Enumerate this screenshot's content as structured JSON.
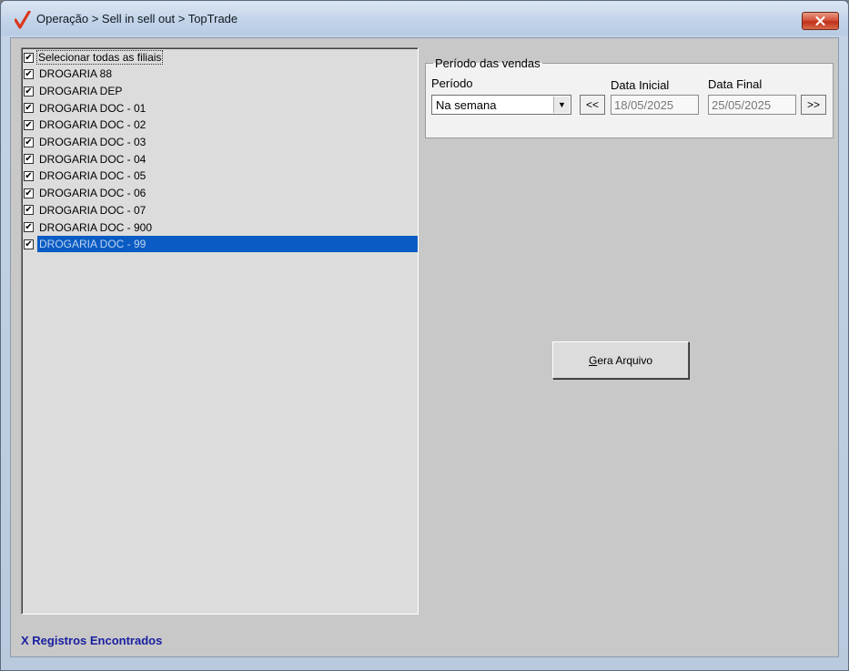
{
  "window": {
    "title": "Operação > Sell in sell out > TopTrade",
    "accent_color": "#d9381e",
    "close_icon": "close-icon"
  },
  "left": {
    "select_all_label": "Selecionar todas as filiais",
    "select_all_checked": true,
    "items": [
      {
        "label": "DROGARIA 88",
        "checked": true
      },
      {
        "label": "DROGARIA DEP",
        "checked": true
      },
      {
        "label": "DROGARIA DOC - 01",
        "checked": true
      },
      {
        "label": "DROGARIA DOC - 02",
        "checked": true
      },
      {
        "label": "DROGARIA DOC - 03",
        "checked": true
      },
      {
        "label": "DROGARIA DOC - 04",
        "checked": true
      },
      {
        "label": "DROGARIA DOC - 05",
        "checked": true
      },
      {
        "label": "DROGARIA DOC - 06",
        "checked": true
      },
      {
        "label": "DROGARIA DOC - 07",
        "checked": true
      },
      {
        "label": "DROGARIA DOC - 900",
        "checked": true
      },
      {
        "label": "DROGARIA DOC - 99",
        "checked": true
      }
    ],
    "selected_item": "DROGARIA DOC - 99",
    "status": "X Registros Encontrados"
  },
  "periodo": {
    "group_title": "Período das vendas",
    "period_label": "Período",
    "period_value": "Na semana",
    "prev_label": "<<",
    "next_label": ">>",
    "start_label": "Data Inicial",
    "start_value": "18/05/2025",
    "end_label": "Data Final",
    "end_value": "25/05/2025"
  },
  "actions": {
    "gera_mnemonic": "G",
    "gera_rest": "era Arquivo"
  },
  "colors": {
    "selection": "#0a5cc4",
    "status_text": "#1a20a0"
  }
}
